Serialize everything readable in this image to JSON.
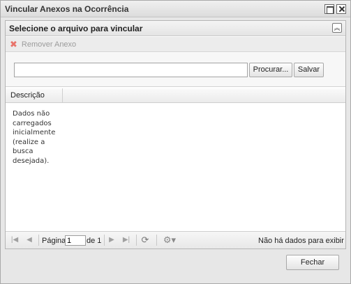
{
  "window": {
    "title": "Vincular Anexos na Ocorrência"
  },
  "panel": {
    "title": "Selecione o arquivo para vincular"
  },
  "toolbar": {
    "remove_label": "Remover Anexo"
  },
  "upload": {
    "file_value": "",
    "browse_label": "Procurar...",
    "save_label": "Salvar"
  },
  "grid": {
    "columns": [
      "Descrição"
    ],
    "empty_message": "Dados não carregados inicialmente (realize a busca desejada)."
  },
  "pager": {
    "page_label": "Página",
    "current_page": "1",
    "of_label": "de 1",
    "status": "Não há dados para exibir"
  },
  "footer": {
    "close_label": "Fechar"
  }
}
